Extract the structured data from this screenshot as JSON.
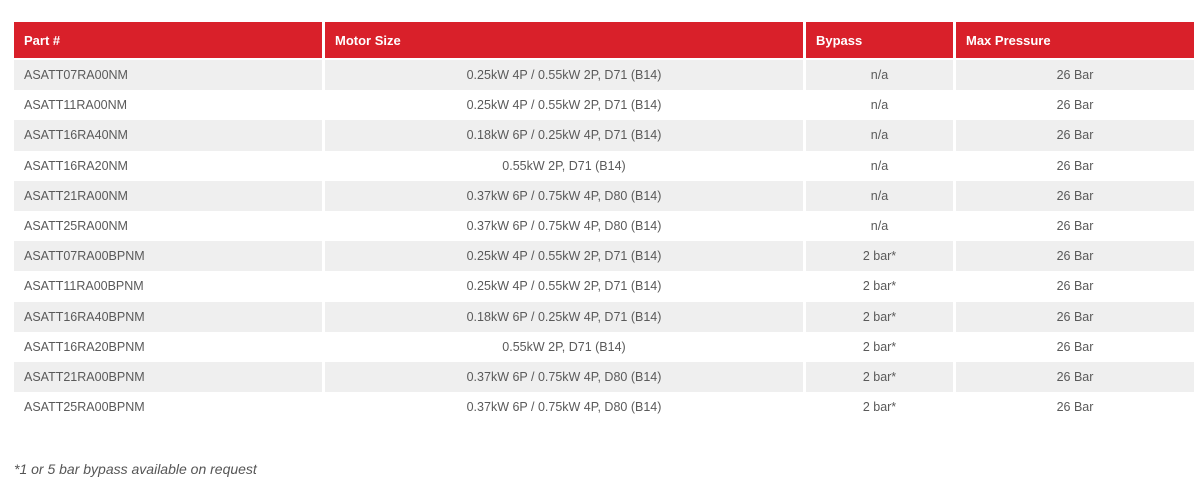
{
  "table": {
    "headers": [
      "Part #",
      "Motor Size",
      "Bypass",
      "Max Pressure"
    ],
    "rows": [
      [
        "ASATT07RA00NM",
        "0.25kW 4P / 0.55kW 2P, D71 (B14)",
        "n/a",
        "26 Bar"
      ],
      [
        "ASATT11RA00NM",
        "0.25kW 4P / 0.55kW 2P, D71 (B14)",
        "n/a",
        "26 Bar"
      ],
      [
        "ASATT16RA40NM",
        "0.18kW 6P / 0.25kW 4P, D71 (B14)",
        "n/a",
        "26 Bar"
      ],
      [
        "ASATT16RA20NM",
        "0.55kW 2P, D71 (B14)",
        "n/a",
        "26 Bar"
      ],
      [
        "ASATT21RA00NM",
        "0.37kW 6P / 0.75kW 4P, D80 (B14)",
        "n/a",
        "26 Bar"
      ],
      [
        "ASATT25RA00NM",
        "0.37kW 6P / 0.75kW 4P, D80 (B14)",
        "n/a",
        "26 Bar"
      ],
      [
        "ASATT07RA00BPNM",
        "0.25kW 4P / 0.55kW 2P, D71 (B14)",
        "2 bar*",
        "26 Bar"
      ],
      [
        "ASATT11RA00BPNM",
        "0.25kW 4P / 0.55kW 2P, D71 (B14)",
        "2 bar*",
        "26 Bar"
      ],
      [
        "ASATT16RA40BPNM",
        "0.18kW 6P / 0.25kW 4P, D71 (B14)",
        "2 bar*",
        "26 Bar"
      ],
      [
        "ASATT16RA20BPNM",
        "0.55kW 2P, D71 (B14)",
        "2 bar*",
        "26 Bar"
      ],
      [
        "ASATT21RA00BPNM",
        "0.37kW 6P / 0.75kW 4P, D80 (B14)",
        "2 bar*",
        "26 Bar"
      ],
      [
        "ASATT25RA00BPNM",
        "0.37kW 6P / 0.75kW 4P, D80 (B14)",
        "2 bar*",
        "26 Bar"
      ]
    ]
  },
  "footnote": "*1 or 5 bar bypass available on request",
  "colors": {
    "header_bg": "#d9202a",
    "header_text": "#ffffff",
    "row_alt_bg": "#efefef",
    "text": "#5a5a5a"
  }
}
